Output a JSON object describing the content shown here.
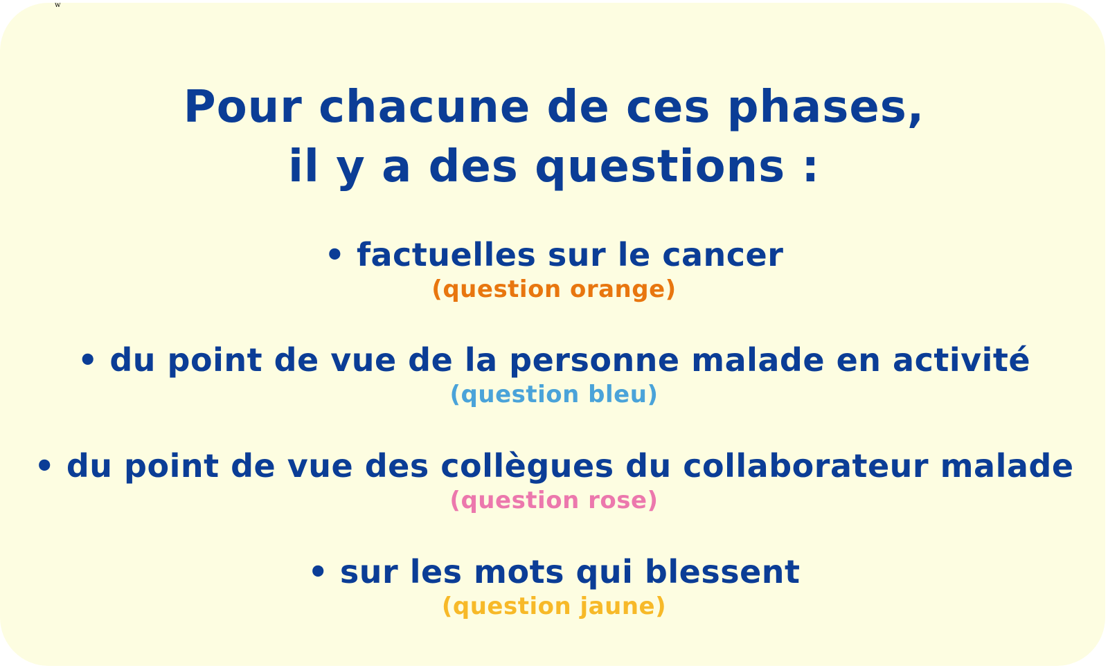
{
  "corner_mark": "w",
  "title": {
    "line1": "Pour chacune de ces phases,",
    "line2": "il y a des questions :"
  },
  "items": [
    {
      "text": "• factuelles sur le cancer",
      "sub": "(question orange)",
      "sub_color": "#e8760f"
    },
    {
      "text": "• du point de vue de la personne malade en activité",
      "sub": "(question bleu)",
      "sub_color": "#4aa3d9"
    },
    {
      "text": "• du point de vue des collègues du collaborateur malade",
      "sub": "(question rose)",
      "sub_color": "#ec78ad"
    },
    {
      "text": "• sur les mots qui blessent",
      "sub": "(question jaune)",
      "sub_color": "#f7b928"
    }
  ],
  "colors": {
    "background": "#fdfde1",
    "text": "#0b3d96"
  }
}
